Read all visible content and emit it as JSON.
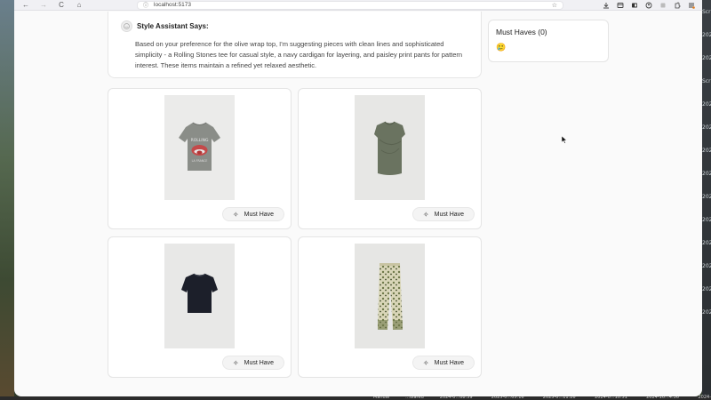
{
  "browser": {
    "url": "localhost:5173",
    "nav": {
      "back": "←",
      "forward": "→",
      "reload": "C",
      "home": "⌂"
    },
    "url_icons": {
      "info": "ⓘ",
      "star": "☆"
    },
    "toolbar_icons": [
      "download-icon",
      "library-icon",
      "sidebar-icon",
      "account-icon",
      "extensions-icon",
      "gear-icon",
      "menu-icon"
    ]
  },
  "assistant": {
    "title": "Style Assistant Says:",
    "message": "Based on your preference for the olive wrap top, I'm suggesting pieces with clean lines and sophisticated simplicity - a Rolling Stones tee for casual style, a navy cardigan for layering, and paisley print pants for pattern interest. These items maintain a refined yet relaxed aesthetic."
  },
  "products": [
    {
      "image": "graphic-tee-grey",
      "button_label": "Must Have"
    },
    {
      "image": "olive-wrap-top",
      "button_label": "Must Have"
    },
    {
      "image": "navy-tee",
      "button_label": "Must Have"
    },
    {
      "image": "paisley-pants",
      "button_label": "Must Have"
    }
  ],
  "must_haves": {
    "title": "Must Haves (0)",
    "emoji": "🥲"
  },
  "desktop": {
    "right_labels": [
      "Scr",
      "202",
      "202",
      "Scr",
      "202",
      "202",
      "202",
      "202",
      "202",
      "202",
      "202",
      "202",
      "202",
      "202"
    ],
    "bottom_labels": [
      "Manual",
      "...ulared",
      "2024-0...08.59 PM",
      "2025-0...05.16 PM",
      "2025-0...11.26 AM",
      "2024-0...10.51 PM",
      "2024-10...4.36 AM",
      "2024-"
    ]
  }
}
